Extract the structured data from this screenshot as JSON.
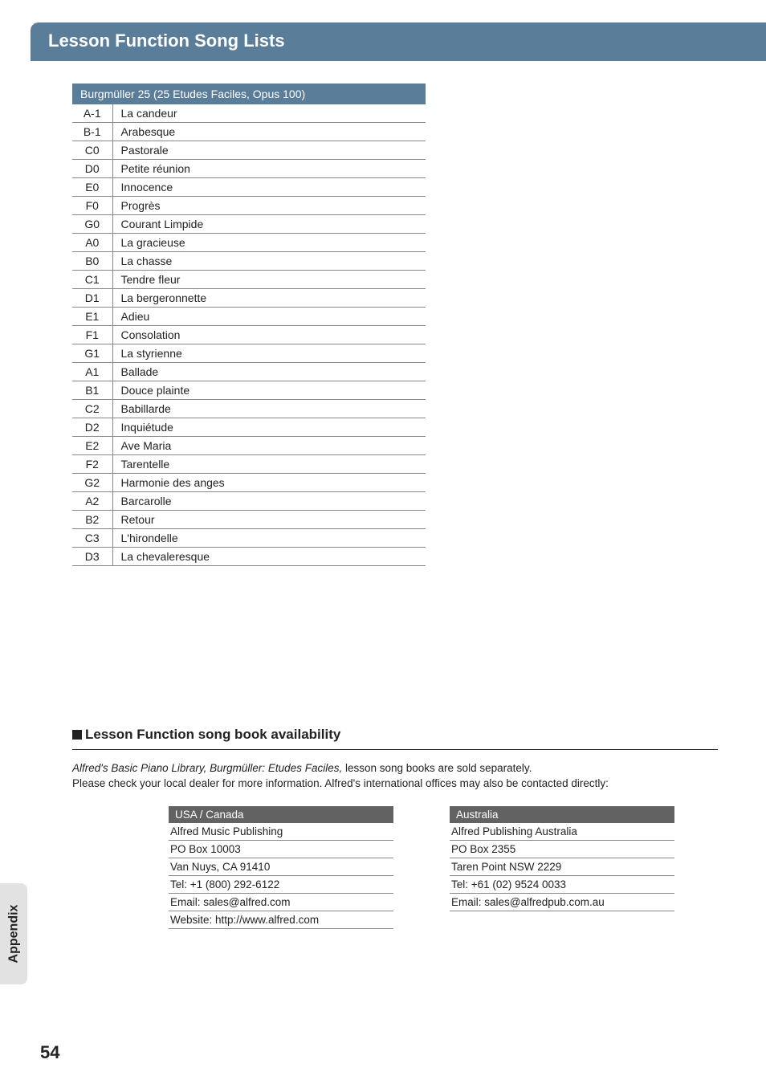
{
  "sideTab": "Appendix",
  "titleBar": "Lesson Function Song Lists",
  "table": {
    "header": "Burgmüller 25 (25 Etudes Faciles, Opus 100)",
    "rows": [
      {
        "key": "A-1",
        "name": "La candeur"
      },
      {
        "key": "B-1",
        "name": "Arabesque"
      },
      {
        "key": "C0",
        "name": "Pastorale"
      },
      {
        "key": "D0",
        "name": "Petite réunion"
      },
      {
        "key": "E0",
        "name": "Innocence"
      },
      {
        "key": "F0",
        "name": "Progrès"
      },
      {
        "key": "G0",
        "name": "Courant Limpide"
      },
      {
        "key": "A0",
        "name": "La gracieuse"
      },
      {
        "key": "B0",
        "name": "La chasse"
      },
      {
        "key": "C1",
        "name": "Tendre fleur"
      },
      {
        "key": "D1",
        "name": "La bergeronnette"
      },
      {
        "key": "E1",
        "name": "Adieu"
      },
      {
        "key": "F1",
        "name": "Consolation"
      },
      {
        "key": "G1",
        "name": "La styrienne"
      },
      {
        "key": "A1",
        "name": "Ballade"
      },
      {
        "key": "B1",
        "name": "Douce plainte"
      },
      {
        "key": "C2",
        "name": "Babillarde"
      },
      {
        "key": "D2",
        "name": "Inquiétude"
      },
      {
        "key": "E2",
        "name": "Ave Maria"
      },
      {
        "key": "F2",
        "name": "Tarentelle"
      },
      {
        "key": "G2",
        "name": "Harmonie des anges"
      },
      {
        "key": "A2",
        "name": "Barcarolle"
      },
      {
        "key": "B2",
        "name": "Retour"
      },
      {
        "key": "C3",
        "name": "L'hirondelle"
      },
      {
        "key": "D3",
        "name": "La chevaleresque"
      }
    ]
  },
  "avail": {
    "heading": "Lesson Function song book availability",
    "line1_italic": "Alfred's Basic Piano Library, Burgmüller: Etudes Faciles,",
    "line1_rest": " lesson song books are sold separately.",
    "line2": "Please check your local dealer for more information. Alfred's international offices may also be contacted directly:"
  },
  "contacts": [
    {
      "head": "USA / Canada",
      "lines": [
        "Alfred Music Publishing",
        "PO Box 10003",
        "Van Nuys, CA 91410",
        "Tel: +1 (800) 292-6122",
        "Email: sales@alfred.com",
        "Website: http://www.alfred.com"
      ]
    },
    {
      "head": "Australia",
      "lines": [
        "Alfred Publishing Australia",
        "PO Box 2355",
        "Taren Point NSW 2229",
        "Tel: +61 (02) 9524 0033",
        "Email: sales@alfredpub.com.au"
      ]
    }
  ],
  "pageNumber": "54"
}
